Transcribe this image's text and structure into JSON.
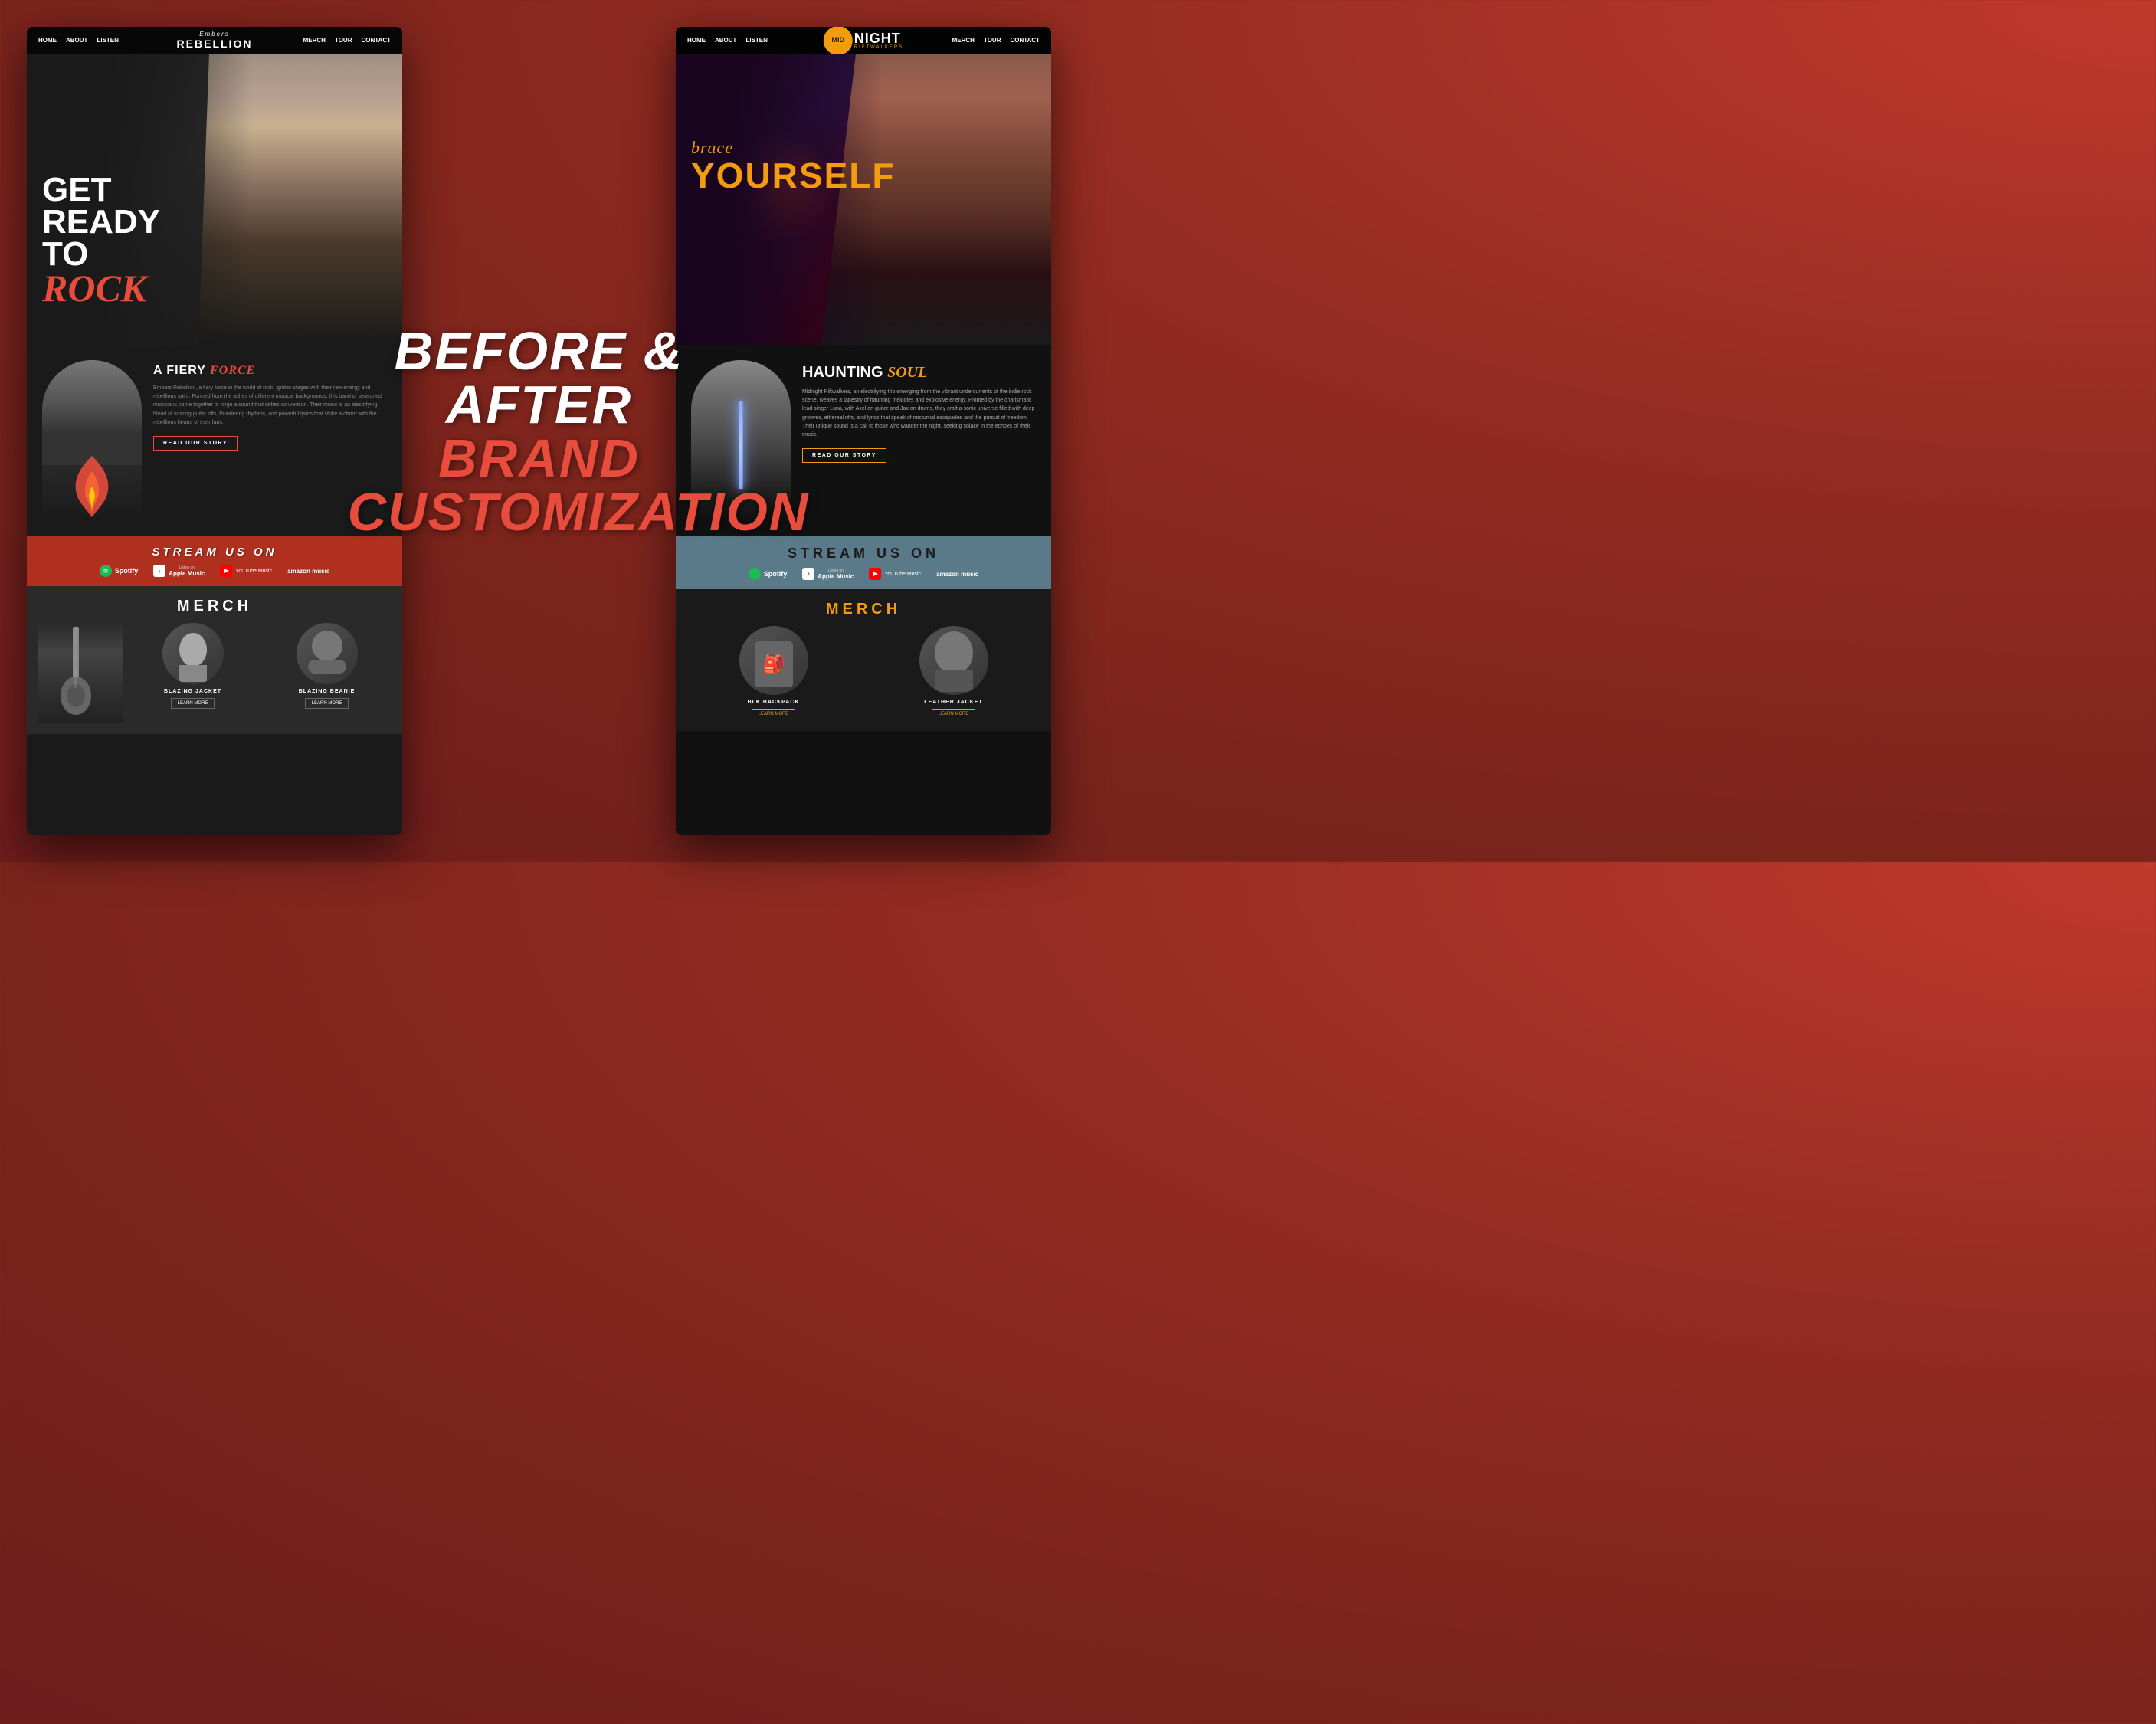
{
  "center_overlay": {
    "line1": "BEFORE & AFTER",
    "line2": "BRAND",
    "line3": "CUSTOMIZATION"
  },
  "left_mockup": {
    "nav": {
      "links": [
        "HOME",
        "ABOUT",
        "LISTEN",
        "MERCH",
        "TOUR",
        "CONTACT"
      ]
    },
    "logo": {
      "sub": "Embers",
      "main": "REBELLION"
    },
    "hero": {
      "line1": "GET",
      "line2": "READY",
      "line3": "TO",
      "line4": "Rock"
    },
    "about": {
      "title": "A FIERY",
      "title_accent": "FORCE",
      "description": "Embers Rebellion, a fiery force in the world of rock, ignites stages with their raw energy and rebellious spirit. Formed from the ashes of different musical backgrounds, this band of seasoned musicians came together to forge a sound that defies convention. Their music is an electrifying blend of soaring guitar riffs, thundering rhythms, and powerful lyrics that strike a chord with the rebellious hearts of their fans.",
      "cta": "READ OUR STORY"
    },
    "stream": {
      "title": "STREAM US ON",
      "platforms": [
        "Spotify",
        "Apple Music",
        "YouTube Music",
        "amazon music"
      ]
    },
    "merch": {
      "title": "MERCH",
      "items": [
        {
          "name": "BLAZING JACKET",
          "cta": "LEARN MORE"
        },
        {
          "name": "BLAZING BEANIE",
          "cta": "LEARN MORE"
        }
      ]
    }
  },
  "right_mockup": {
    "nav": {
      "links": [
        "HOME",
        "ABOUT",
        "LISTEN",
        "MERCH",
        "TOUR",
        "CONTACT"
      ]
    },
    "logo": {
      "mid": "MID",
      "night": "NIGHT",
      "sub": "RIFTWALKERS"
    },
    "hero": {
      "brace": "brace",
      "yourself": "YOURSELF"
    },
    "about": {
      "title": "HAUNTING",
      "title_accent": "SOUL",
      "description": "Midnight Riftwalkers, an electrifying trio emerging from the vibrant undercurrents of the indie rock scene, weaves a tapestry of haunting melodies and explosive energy. Fronted by the charismatic lead singer Luna, with Axel on guitar and Jax on drums, they craft a sonic universe filled with deep grooves, ethereal riffs, and lyrics that speak of nocturnal escapades and the pursuit of freedom. Their unique sound is a call to those who wander the night, seeking solace in the echoes of their music.",
      "cta": "READ OUR STORY"
    },
    "stream": {
      "title": "STREAM US ON",
      "platforms": [
        "Spotify",
        "Apple Music",
        "YouTube Music",
        "amazon music"
      ]
    },
    "merch": {
      "title": "MERCH",
      "items": [
        {
          "name": "BLK BACKPACK",
          "cta": "LEARN MORE"
        },
        {
          "name": "LEATHER JACKET",
          "cta": "LEARN MORE"
        }
      ]
    }
  }
}
